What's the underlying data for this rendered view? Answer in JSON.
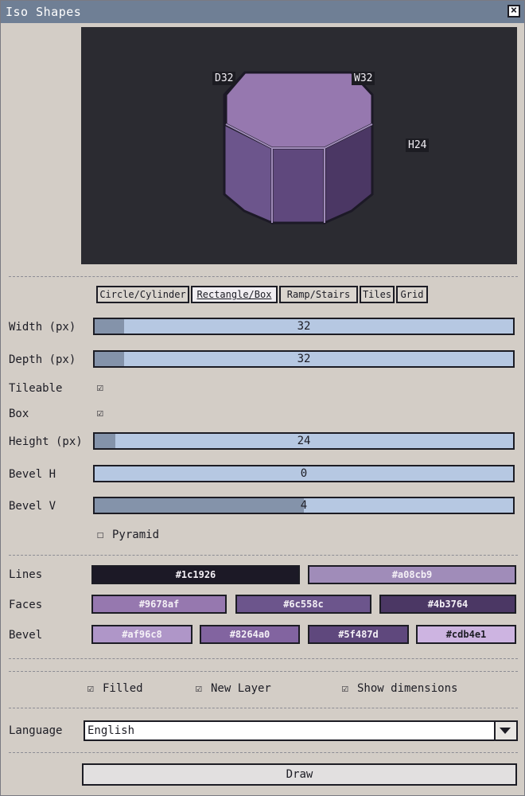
{
  "window": {
    "title": "Iso Shapes",
    "close_icon": "close-icon"
  },
  "preview": {
    "dimensions": {
      "depth": "D32",
      "width": "W32",
      "height": "H24"
    },
    "colors": {
      "background": "#2b2b31",
      "top": "#9678af",
      "left": "#6c558c",
      "right": "#4b3764",
      "front": "#5f487d",
      "outline": "#1c1926"
    }
  },
  "tabs": [
    {
      "label": "Circle/Cylinder",
      "active": false
    },
    {
      "label": "Rectangle/Box",
      "active": true
    },
    {
      "label": "Ramp/Stairs",
      "active": false
    },
    {
      "label": "Tiles",
      "active": false
    },
    {
      "label": "Grid",
      "active": false
    }
  ],
  "fields": {
    "width": {
      "label": "Width (px)",
      "value": "32",
      "fraction": 0.07
    },
    "depth": {
      "label": "Depth (px)",
      "value": "32",
      "fraction": 0.07
    },
    "tileable": {
      "label": "Tileable",
      "checked": true
    },
    "box": {
      "label": "Box",
      "checked": true
    },
    "height": {
      "label": "Height (px)",
      "value": "24",
      "fraction": 0.05
    },
    "bevel_h": {
      "label": "Bevel H",
      "value": "0",
      "fraction": 0.0
    },
    "bevel_v": {
      "label": "Bevel V",
      "value": "4",
      "fraction": 0.5
    },
    "pyramid": {
      "label": "Pyramid",
      "checked": false
    }
  },
  "colors": {
    "lines_label": "Lines",
    "lines": [
      "#1c1926",
      "#a08cb9"
    ],
    "faces_label": "Faces",
    "faces": [
      "#9678af",
      "#6c558c",
      "#4b3764"
    ],
    "bevel_label": "Bevel",
    "bevel": [
      "#af96c8",
      "#8264a0",
      "#5f487d",
      "#cdb4e1"
    ]
  },
  "options": {
    "filled": {
      "label": "Filled",
      "checked": true
    },
    "new_layer": {
      "label": "New Layer",
      "checked": true
    },
    "show_dimensions": {
      "label": "Show dimensions",
      "checked": true
    }
  },
  "language": {
    "label": "Language",
    "value": "English"
  },
  "draw_label": "Draw"
}
